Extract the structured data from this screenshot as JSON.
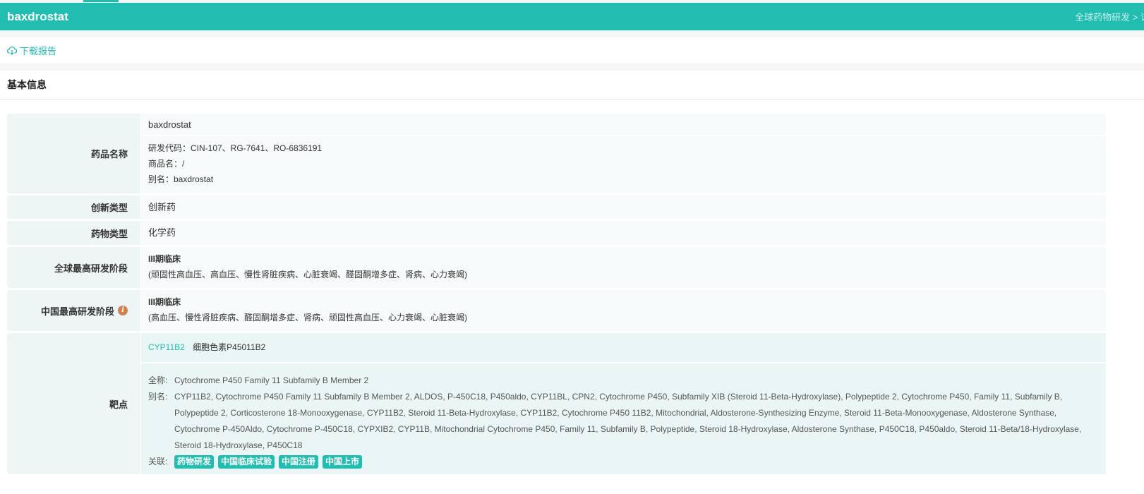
{
  "header": {
    "title": "baxdrostat",
    "breadcrumb": "全球药物研发 > 详"
  },
  "toolbar": {
    "download_label": "下载报告"
  },
  "section": {
    "title": "基本信息"
  },
  "rows": {
    "name": {
      "label": "药品名称",
      "main": "baxdrostat",
      "code": "研发代码：CIN-107、RG-7641、RO-6836191",
      "trade": "商品名：/",
      "alias": "别名：baxdrostat"
    },
    "innovation": {
      "label": "创新类型",
      "value": "创新药"
    },
    "drug_type": {
      "label": "药物类型",
      "value": "化学药"
    },
    "global_phase": {
      "label": "全球最高研发阶段",
      "phase": "III期临床",
      "indications": "(顽固性高血压、高血压、慢性肾脏疾病、心脏衰竭、醛固酮增多症、肾病、心力衰竭)"
    },
    "china_phase": {
      "label": "中国最高研发阶段",
      "phase": "III期临床",
      "indications": "(高血压、慢性肾脏疾病、醛固酮增多症、肾病、顽固性高血压、心力衰竭、心脏衰竭)"
    },
    "target": {
      "label": "靶点",
      "symbol": "CYP11B2",
      "cn_name": "细胞色素P45011B2",
      "fullname_key": "全称:",
      "fullname": "Cytochrome P450 Family 11 Subfamily B Member 2",
      "alias_key": "别名:",
      "aliases": "CYP11B2, Cytochrome P450 Family 11 Subfamily B Member 2, ALDOS, P-450C18, P450aldo, CYP11BL, CPN2, Cytochrome P450, Subfamily XIB (Steroid 11-Beta-Hydroxylase), Polypeptide 2, Cytochrome P450, Family 11, Subfamily B, Polypeptide 2, Corticosterone 18-Monooxygenase, CYP11B2, Steroid 11-Beta-Hydroxylase, CYP11B2, Cytochrome P450 11B2, Mitochondrial, Aldosterone-Synthesizing Enzyme, Steroid 11-Beta-Monooxygenase, Aldosterone Synthase, Cytochrome P-450Aldo, Cytochrome P-450C18, CYPXIB2, CYP11B, Mitochondrial Cytochrome P450, Family 11, Subfamily B, Polypeptide, Steroid 18-Hydroxylase, Aldosterone Synthase, P450C18, P450aldo, Steroid 11-Beta/18-Hydroxylase, Steroid 18-Hydroxylase, P450C18",
      "related_key": "关联:",
      "tags": [
        "药物研发",
        "中国临床试验",
        "中国注册",
        "中国上市"
      ]
    }
  },
  "colors": {
    "accent": "#20bdb0",
    "info": "#d2804f"
  }
}
